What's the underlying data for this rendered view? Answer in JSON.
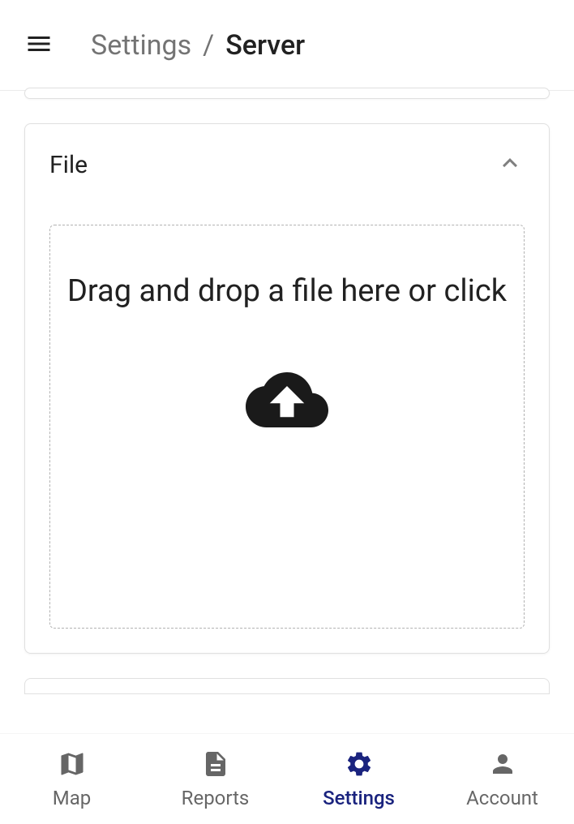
{
  "header": {
    "breadcrumb_parent": "Settings",
    "breadcrumb_separator": "/",
    "breadcrumb_current": "Server"
  },
  "file_section": {
    "title": "File",
    "dropzone_text": "Drag and drop a file here or click"
  },
  "nav": {
    "items": [
      {
        "label": "Map"
      },
      {
        "label": "Reports"
      },
      {
        "label": "Settings"
      },
      {
        "label": "Account"
      }
    ],
    "active_index": 2
  },
  "colors": {
    "accent": "#1a237e"
  }
}
